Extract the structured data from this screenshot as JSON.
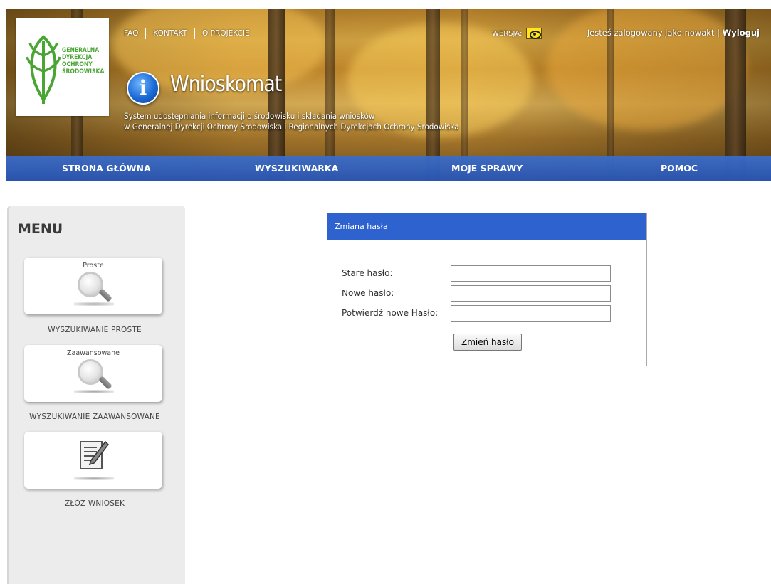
{
  "logo": {
    "lines": [
      "GENERALNA",
      "DYREKCJA",
      "OCHRONY",
      "ŚRODOWISKA"
    ]
  },
  "topnav": {
    "items": [
      "FAQ",
      "KONTAKT",
      "O PROJEKCIE"
    ]
  },
  "version": {
    "label": "WERSJA:"
  },
  "login": {
    "text": "Jesteś zalogowany jako nowakt",
    "separator": "|",
    "logout": "Wyloguj"
  },
  "app": {
    "title": "Wnioskomat",
    "subtitle_line1": "System udostępniania informacji o środowisku i składania wniosków",
    "subtitle_line2": "w Generalnej Dyrekcji Ochrony Środowiska i Regionalnych Dyrekcjach Ochrony Środowiska"
  },
  "mainnav": {
    "items": [
      "STRONA GŁÓWNA",
      "WYSZUKIWARKA",
      "MOJE SPRAWY",
      "POMOC"
    ]
  },
  "sidebar": {
    "title": "MENU",
    "cards": [
      {
        "label": "Proste",
        "caption": "WYSZUKIWANIE PROSTE",
        "icon": "magnifier-icon"
      },
      {
        "label": "Zaawansowane",
        "caption": "WYSZUKIWANIE ZAAWANSOWANE",
        "icon": "magnifier-icon"
      },
      {
        "label": "",
        "caption": "ZŁÓŻ WNIOSEK",
        "icon": "document-edit-icon"
      }
    ]
  },
  "panel": {
    "title": "Zmiana hasła",
    "fields": [
      {
        "label": "Stare hasło:",
        "value": ""
      },
      {
        "label": "Nowe hasło:",
        "value": ""
      },
      {
        "label": "Potwierdź nowe Hasło:",
        "value": ""
      }
    ],
    "submit": "Zmień hasło"
  },
  "colors": {
    "nav_blue": "#2e63cf",
    "logo_green": "#4aa534"
  }
}
